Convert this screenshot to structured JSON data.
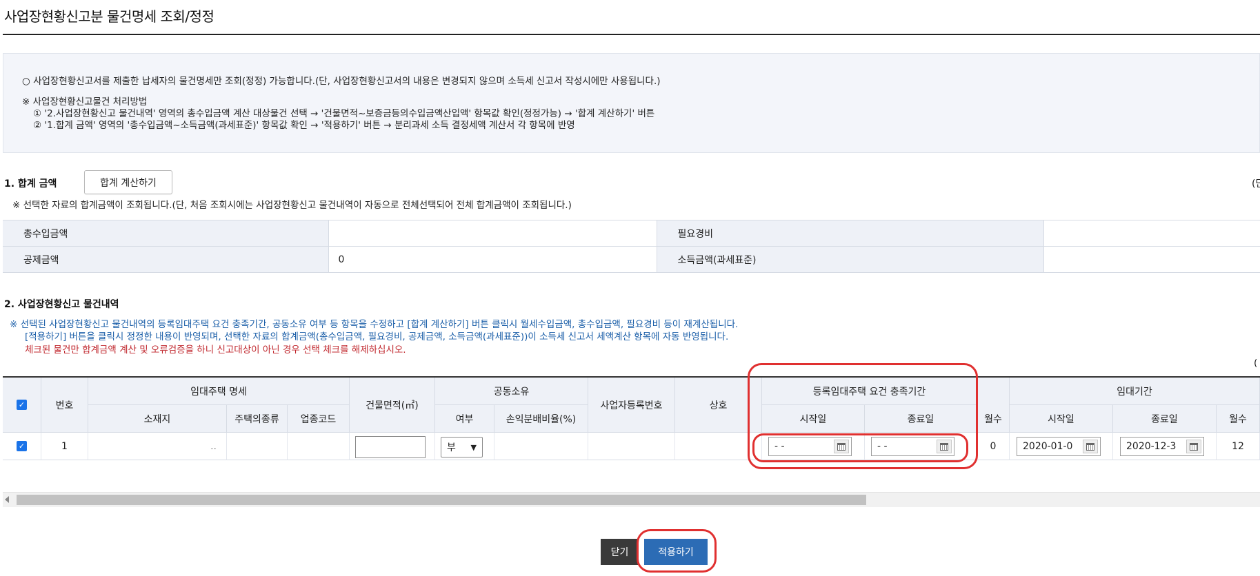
{
  "page": {
    "title": "사업장현황신고분 물건명세 조회/정정"
  },
  "notice": {
    "line1": "○ 사업장현황신고서를 제출한 납세자의 물건명세만 조회(정정) 가능합니다.(단, 사업장현황신고서의 내용은 변경되지 않으며 소득세 신고서 작성시에만 사용됩니다.)",
    "line2": "※ 사업장현황신고물건 처리방법",
    "line3": "① '2.사업장현황신고 물건내역' 영역의 총수입금액 계산 대상물건 선택 → '건물면적~보증금등의수입금액산입액' 항목값 확인(정정가능) → '합계 계산하기' 버튼",
    "line4": "② '1.합계 금액' 영역의 '총수입금액~소득금액(과세표준)' 항목값 확인 → '적용하기' 버튼 → 분리과세 소득 결정세액 계산서 각 항목에 반영"
  },
  "section1": {
    "title": "1. 합계 금액",
    "calc_button": "합계 계산하기",
    "unit_cut": "(단",
    "note": "※ 선택한 자료의 합계금액이 조회됩니다.(단, 처음 조회시에는 사업장현황신고 물건내역이 자동으로 전체선택되어 전체 합계금액이 조회됩니다.)",
    "rows": [
      {
        "label1": "총수입금액",
        "value1": "",
        "label2": "필요경비",
        "value2": ""
      },
      {
        "label1": "공제금액",
        "value1": "0",
        "label2": "소득금액(과세표준)",
        "value2": ""
      }
    ]
  },
  "section2": {
    "title": "2. 사업장현황신고 물건내역",
    "note1": "※ 선택된 사업장현황신고 물건내역의 등록임대주택 요건 충족기간, 공동소유 여부 등 항목을 수정하고 [합계 계산하기] 버튼 클릭시 월세수입금액, 총수입금액, 필요경비 등이 재계산됩니다.",
    "note2": "[적용하기] 버튼을 클릭시 정정한 내용이 반영되며, 선택한 자료의 합계금액(총수입금액, 필요경비, 공제금액, 소득금액(과세표준))이 소득세 신고서 세액계산 항목에 자동 반영됩니다.",
    "note3": "체크된 물건만 합계금액 계산 및 오류검증을 하니 신고대상이 아닌 경우 선택 체크를 해제하십시오.",
    "right_cut": "(",
    "headers": {
      "no": "번호",
      "rental_spec": "임대주택 명세",
      "location": "소재지",
      "housing_type": "주택의종류",
      "industry_code": "업종코드",
      "building_area": "건물면적(㎡)",
      "joint_own": "공동소유",
      "joint_yn": "여부",
      "profit_ratio": "손익분배비율(%)",
      "biz_reg_no": "사업자등록번호",
      "trade_name": "상호",
      "req_period": "등록임대주택 요건 충족기간",
      "req_start": "시작일",
      "req_end": "종료일",
      "months1": "월수",
      "lease_period": "임대기간",
      "lease_start": "시작일",
      "lease_end": "종료일",
      "months2": "월수"
    },
    "rows": [
      {
        "checked": true,
        "no": "1",
        "location": "..",
        "housing_type": "",
        "industry_code": "",
        "building_area": "",
        "joint_yn": "부",
        "profit_ratio": "",
        "biz_reg_no": "",
        "trade_name": "",
        "req_start": "- -",
        "req_end": "- -",
        "months1": "0",
        "lease_start": "2020-01-0",
        "lease_end": "2020-12-3",
        "months2": "12"
      }
    ]
  },
  "buttons": {
    "close": "닫기",
    "apply": "적용하기"
  },
  "colors": {
    "annotation": "#e03030",
    "apply_button": "#2c6cb5",
    "close_button": "#3a3a3a",
    "header_bg": "#eef1f7"
  }
}
